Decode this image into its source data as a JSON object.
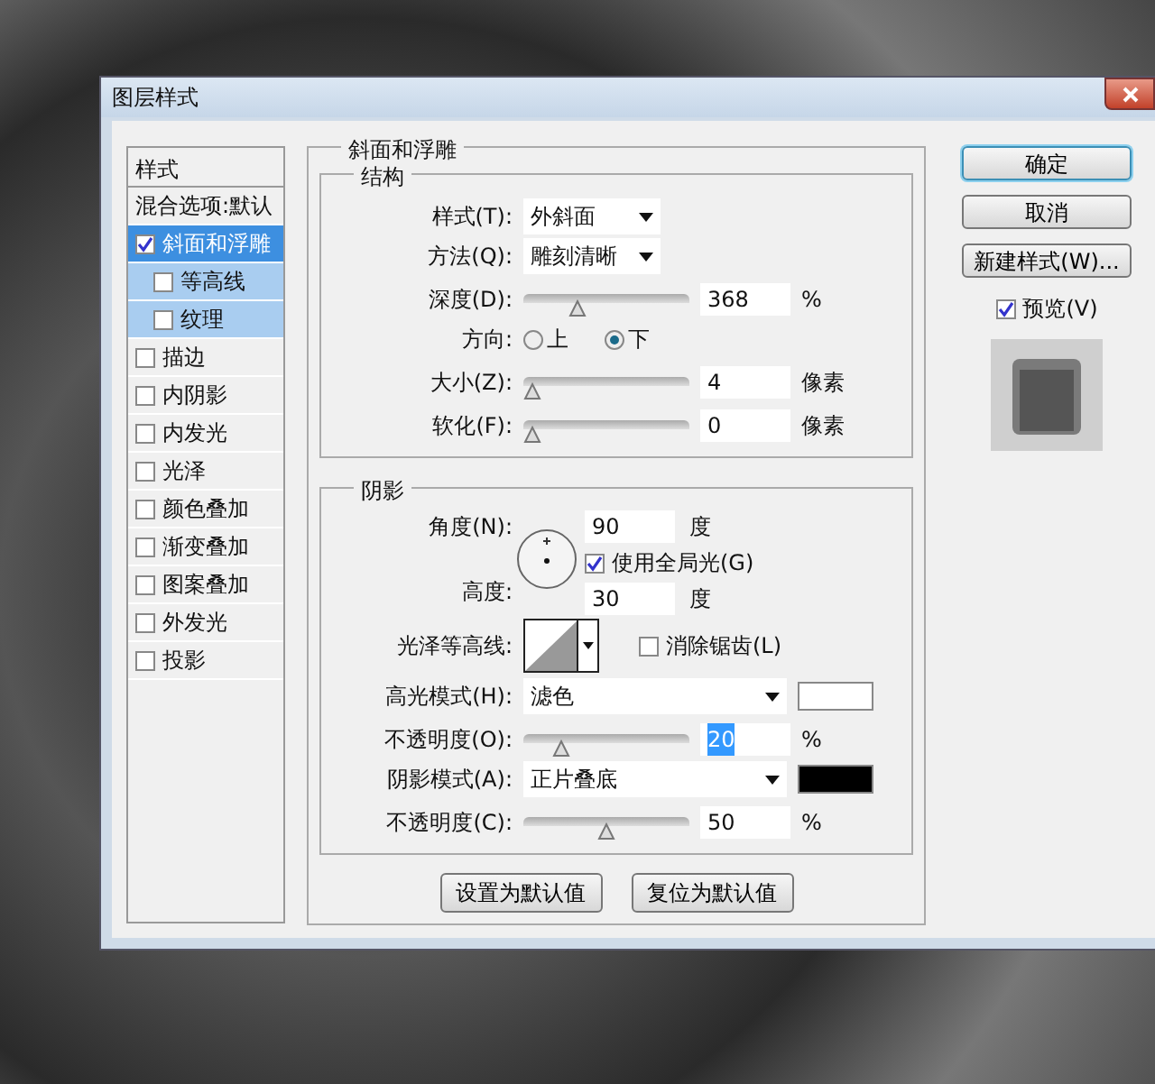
{
  "window": {
    "title": "图层样式"
  },
  "styles_panel": {
    "header": "样式",
    "items": [
      {
        "label": "混合选项:默认",
        "kind": "plain",
        "selected": false
      },
      {
        "label": "斜面和浮雕",
        "kind": "checkbox",
        "checked": true,
        "selected": true,
        "children": [
          {
            "label": "等高线",
            "kind": "checkbox",
            "checked": false,
            "selected": false
          },
          {
            "label": "纹理",
            "kind": "checkbox",
            "checked": false,
            "selected": false
          }
        ]
      },
      {
        "label": "描边",
        "kind": "checkbox",
        "checked": false,
        "selected": false
      },
      {
        "label": "内阴影",
        "kind": "checkbox",
        "checked": false,
        "selected": false
      },
      {
        "label": "内发光",
        "kind": "checkbox",
        "checked": false,
        "selected": false
      },
      {
        "label": "光泽",
        "kind": "checkbox",
        "checked": false,
        "selected": false
      },
      {
        "label": "颜色叠加",
        "kind": "checkbox",
        "checked": false,
        "selected": false
      },
      {
        "label": "渐变叠加",
        "kind": "checkbox",
        "checked": false,
        "selected": false
      },
      {
        "label": "图案叠加",
        "kind": "checkbox",
        "checked": false,
        "selected": false
      },
      {
        "label": "外发光",
        "kind": "checkbox",
        "checked": false,
        "selected": false
      },
      {
        "label": "投影",
        "kind": "checkbox",
        "checked": false,
        "selected": false
      }
    ]
  },
  "bevel": {
    "title": "斜面和浮雕",
    "structure": {
      "title": "结构",
      "rows": [
        {
          "kind": "select",
          "label": "样式(T):",
          "value": "外斜面"
        },
        {
          "kind": "select",
          "label": "方法(Q):",
          "value": "雕刻清晰"
        },
        {
          "kind": "slider",
          "label": "深度(D):",
          "level": 0.3,
          "value": "368",
          "unit": "%",
          "selected": false
        },
        {
          "kind": "radio",
          "label": "方向:",
          "options": [
            {
              "label": "上",
              "selected": false
            },
            {
              "label": "下",
              "selected": true
            }
          ]
        },
        {
          "kind": "slider",
          "label": "大小(Z):",
          "level": 0.0,
          "value": "4",
          "unit": "像素",
          "selected": false
        },
        {
          "kind": "slider",
          "label": "软化(F):",
          "level": 0.0,
          "value": "0",
          "unit": "像素",
          "selected": false
        }
      ]
    },
    "shading": {
      "title": "阴影",
      "angle": {
        "label": "角度(N):",
        "value": "90",
        "unit": "度"
      },
      "global_light": {
        "label": "使用全局光(G)",
        "checked": true
      },
      "altitude": {
        "label": "高度:",
        "value": "30",
        "unit": "度"
      },
      "gloss_contour": {
        "label": "光泽等高线:"
      },
      "anti_aliased": {
        "label": "消除锯齿(L)",
        "checked": false
      },
      "rows": [
        {
          "kind": "mode",
          "label": "高光模式(H):",
          "value": "滤色",
          "color": "#ffffff"
        },
        {
          "kind": "slider",
          "label": "不透明度(O):",
          "level": 0.2,
          "value": "20",
          "unit": "%",
          "selected": true
        },
        {
          "kind": "mode",
          "label": "阴影模式(A):",
          "value": "正片叠底",
          "color": "#000000"
        },
        {
          "kind": "slider",
          "label": "不透明度(C):",
          "level": 0.5,
          "value": "50",
          "unit": "%",
          "selected": false
        }
      ]
    },
    "buttons": [
      "设置为默认值",
      "复位为默认值"
    ]
  },
  "actions": [
    {
      "label": "确定",
      "default": true
    },
    {
      "label": "取消",
      "default": false
    },
    {
      "label": "新建样式(W)...",
      "default": false
    }
  ],
  "preview": {
    "label": "预览(V)",
    "checked": true
  }
}
